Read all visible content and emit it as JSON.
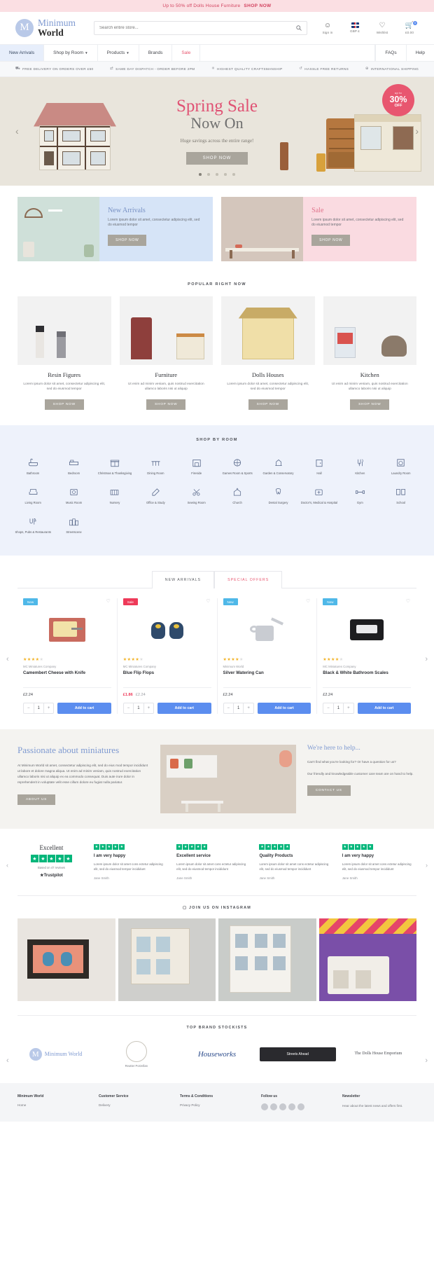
{
  "announcement": {
    "text": "Up to 50% off Dolls House Furniture",
    "cta": "SHOP NOW"
  },
  "header": {
    "logo": {
      "mark": "M",
      "line1": "Minimum",
      "line2": "World"
    },
    "search": {
      "placeholder": "Search entire store...",
      "value": "",
      "icon": "search-icon"
    },
    "actions": [
      {
        "icon": "user-icon",
        "glyph": "☳",
        "label": "Sign in"
      },
      {
        "icon": "uk-flag-icon",
        "glyph": "",
        "label": "GBP £"
      },
      {
        "icon": "heart-icon",
        "glyph": "♡",
        "label": "Wishlist"
      },
      {
        "icon": "cart-icon",
        "glyph": "⛃",
        "label": "£0.00",
        "badge": "0"
      }
    ]
  },
  "nav": {
    "left": [
      {
        "label": "New Arrivals",
        "active": true,
        "caret": false
      },
      {
        "label": "Shop by Room",
        "active": false,
        "caret": true
      },
      {
        "label": "Products",
        "active": false,
        "caret": true
      },
      {
        "label": "Brands",
        "active": false,
        "caret": false
      },
      {
        "label": "Sale",
        "active": false,
        "caret": false,
        "sale": true
      }
    ],
    "right": [
      {
        "label": "FAQs"
      },
      {
        "label": "Help"
      }
    ]
  },
  "usp": [
    {
      "icon": "truck-icon",
      "glyph": "⛟",
      "text": "FREE DELIVERY ON ORDERS OVER £50"
    },
    {
      "icon": "clock-icon",
      "glyph": "⇄",
      "text": "SAME DAY DISPATCH - ORDER BEFORE 2PM"
    },
    {
      "icon": "star-icon",
      "glyph": "✳",
      "text": "HIGHEST QUALITY CRAFTSMANSHIP"
    },
    {
      "icon": "return-icon",
      "glyph": "↺",
      "text": "HASSLE FREE RETURNS"
    },
    {
      "icon": "globe-icon",
      "glyph": "⊕",
      "text": "INTERNATIONAL SHIPPING"
    }
  ],
  "hero": {
    "title_line1": "Spring Sale",
    "title_line2": "Now On",
    "subtitle": "Huge savings across the entire range!",
    "button": "SHOP NOW",
    "badge": {
      "up_to": "up to",
      "percent": "30%",
      "off": "OFF"
    },
    "prev_icon": "chevron-left-icon",
    "next_icon": "chevron-right-icon",
    "dots_total": 5,
    "dot_active": 1,
    "accent": "#e05274",
    "bg": "#e9e5dc"
  },
  "promos": [
    {
      "title": "New Arrivals",
      "text": "Lorem ipsum dolor sit amet, consectetur adipiscing elit, sed do eiusmod tempor",
      "button": "SHOP NOW",
      "color": "#7891c4"
    },
    {
      "title": "Sale",
      "text": "Lorem ipsum dolor sit amet, consectetur adipiscing elit, sed do eiusmod tempor",
      "button": "SHOP NOW",
      "color": "#e0738b"
    }
  ],
  "popular": {
    "heading": "POPULAR RIGHT NOW",
    "items": [
      {
        "name": "Resin Figures",
        "desc": "Lorem ipsum dolor sit amet, consectetur adipiscing elit, sed do eiusmod tempor",
        "button": "SHOP NOW"
      },
      {
        "name": "Furniture",
        "desc": "Ut enim ad minim veniam, quis nostrud exercitation ullamco laboris nisi ut aliquip",
        "button": "SHOP NOW"
      },
      {
        "name": "Dolls Houses",
        "desc": "Lorem ipsum dolor sit amet, consectetur adipiscing elit, sed do eiusmod tempor",
        "button": "SHOP NOW"
      },
      {
        "name": "Kitchen",
        "desc": "Ut enim ad minim veniam, quis nostrud exercitation ullamco laboris nisi ut aliquip",
        "button": "SHOP NOW"
      }
    ]
  },
  "rooms": {
    "heading": "SHOP BY ROOM",
    "items": [
      {
        "label": "Bathroom",
        "icon": "bathtub-icon",
        "glyph": "☐"
      },
      {
        "label": "Bedroom",
        "icon": "bed-icon",
        "glyph": "☳"
      },
      {
        "label": "Christmas & Thanksgiving",
        "icon": "gift-icon",
        "glyph": "⌧"
      },
      {
        "label": "Dining Room",
        "icon": "dining-icon",
        "glyph": "▦"
      },
      {
        "label": "Fireside",
        "icon": "fireplace-icon",
        "glyph": "△"
      },
      {
        "label": "Games Room & Sports",
        "icon": "games-icon",
        "glyph": "⚽"
      },
      {
        "label": "Garden & Conservatory",
        "icon": "garden-icon",
        "glyph": "⚘"
      },
      {
        "label": "Hall",
        "icon": "hall-icon",
        "glyph": "▭"
      },
      {
        "label": "Kitchen",
        "icon": "kitchen-icon",
        "glyph": "♨"
      },
      {
        "label": "Laundry Room",
        "icon": "laundry-icon",
        "glyph": "◎"
      },
      {
        "label": "Living Room",
        "icon": "sofa-icon",
        "glyph": "▰"
      },
      {
        "label": "Music Room",
        "icon": "music-icon",
        "glyph": "♫"
      },
      {
        "label": "Nursery",
        "icon": "crib-icon",
        "glyph": "☷"
      },
      {
        "label": "Office & Study",
        "icon": "desk-icon",
        "glyph": "✎"
      },
      {
        "label": "Sewing Room",
        "icon": "sewing-icon",
        "glyph": "✂"
      },
      {
        "label": "Church",
        "icon": "church-icon",
        "glyph": "⛪"
      },
      {
        "label": "Dental Surgery",
        "icon": "tooth-icon",
        "glyph": "⚕"
      },
      {
        "label": "Doctor's, Medical & Hospital",
        "icon": "medical-icon",
        "glyph": "⨁"
      },
      {
        "label": "Gym",
        "icon": "dumbbell-icon",
        "glyph": "⛓"
      },
      {
        "label": "School",
        "icon": "book-icon",
        "glyph": "◫"
      },
      {
        "label": "Shops, Pubs & Restaurants",
        "icon": "shop-icon",
        "glyph": "✆"
      },
      {
        "label": "Streetscene",
        "icon": "street-icon",
        "glyph": "▤"
      }
    ]
  },
  "product_tabs": [
    {
      "label": "NEW ARRIVALS",
      "active": true
    },
    {
      "label": "SPECIAL OFFERS",
      "active": false,
      "sale": true
    }
  ],
  "products": [
    {
      "badge": "New",
      "badge_type": "new",
      "brand": "MC Miniatures Company",
      "name": "Camembert Cheese with Knife",
      "stars": 4,
      "stars_total": 5,
      "price": "£2.24",
      "sale_price": null,
      "old_price": null,
      "qty": "1",
      "add_label": "Add to cart"
    },
    {
      "badge": "Sale",
      "badge_type": "sale",
      "brand": "MC Miniatures Company",
      "name": "Blue Flip Flops",
      "stars": 4,
      "stars_total": 5,
      "price": null,
      "sale_price": "£1.86",
      "old_price": "£2.24",
      "qty": "1",
      "add_label": "Add to cart"
    },
    {
      "badge": "New",
      "badge_type": "new",
      "brand": "Minimum World",
      "name": "Silver Watering Can",
      "stars": 4,
      "stars_total": 5,
      "price": "£2.24",
      "sale_price": null,
      "old_price": null,
      "qty": "1",
      "add_label": "Add to cart"
    },
    {
      "badge": "New",
      "badge_type": "new",
      "brand": "MC Miniatures Company",
      "name": "Black & White Bathroom Scales",
      "stars": 4,
      "stars_total": 5,
      "price": "£2.24",
      "sale_price": null,
      "old_price": null,
      "qty": "1",
      "add_label": "Add to cart"
    }
  ],
  "passion": {
    "heading": "Passionate about miniatures",
    "body": "At Minimum World sit amet, consectetur adipiscing elit, sed do eius mod tempor incididunt ut labore et dolore magna aliqua. Ut enim ad minim veniam, quis nostrud exercitation ullamco laboris nisi ut aliquip ex ea commodo consequat. Duis aute irure dolor in reprehenderit in voluptate velit esse cillum dolore eu fugiat nulla pariatur.",
    "button": "ABOUT US",
    "help_heading": "We're here to help...",
    "help_body_1": "Can't find what you're looking for? Or have a question for us?",
    "help_body_2": "Our friendly and knowledgeable customer care team are on hand to help.",
    "help_button": "CONTACT US"
  },
  "trustpilot": {
    "title": "Excellent",
    "rating_stars": 5,
    "based_on": "Based on 47 reviews",
    "logo": "★Trustpilot",
    "prev_icon": "chevron-left-icon",
    "next_icon": "chevron-right-icon",
    "reviews": [
      {
        "stars": 5,
        "title": "I am very happy",
        "body": "Lorem ipsum dolor sit amet cons ectetur adipiscing elit, sed do eiusmod tempor incididunt",
        "author": "Jane Smith"
      },
      {
        "stars": 5,
        "title": "Excellent service",
        "body": "Lorem ipsum dolor sit amet cons ectetur adipiscing elit, sed do eiusmod tempor incididunt",
        "author": "Jane Smith"
      },
      {
        "stars": 5,
        "title": "Quality Products",
        "body": "Lorem ipsum dolor sit amet cons ectetur adipiscing elit, sed do eiusmod tempor incididunt",
        "author": "Jane Smith"
      },
      {
        "stars": 5,
        "title": "I am very happy",
        "body": "Lorem ipsum dolor sit amet cons ectetur adipiscing elit, sed do eiusmod tempor incididunt",
        "author": "Jane Smith"
      }
    ]
  },
  "instagram": {
    "heading": "JOIN US ON INSTAGRAM",
    "icon": "instagram-icon"
  },
  "brands": {
    "heading": "TOP BRAND STOCKISTS",
    "items": [
      {
        "name": "Minimum World"
      },
      {
        "name": "Reutter Porzellan"
      },
      {
        "name": "Houseworks"
      },
      {
        "name": "Streets Ahead"
      },
      {
        "name": "The Dolls House Emporium"
      }
    ]
  },
  "footer": {
    "columns": [
      {
        "title": "Minimum World",
        "links": [
          "Home"
        ]
      },
      {
        "title": "Customer Service",
        "links": [
          "Delivery"
        ]
      },
      {
        "title": "Terms & Conditions",
        "links": [
          "Privacy Policy"
        ]
      },
      {
        "title": "Follow us",
        "links": []
      },
      {
        "title": "Newsletter",
        "links": []
      }
    ],
    "newsletter_text": "Hear about the latest news and offers first."
  }
}
